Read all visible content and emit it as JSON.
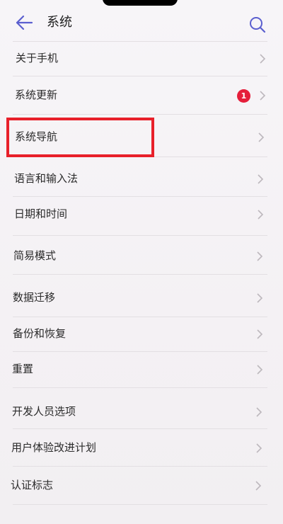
{
  "header": {
    "title": "系统",
    "back_icon": "back-arrow-icon",
    "search_icon": "search-icon"
  },
  "colors": {
    "accent": "#5b5fcf",
    "badge": "#e51e3a",
    "highlight": "#e8202a"
  },
  "settings": {
    "items": [
      {
        "label": "关于手机"
      },
      {
        "label": "系统更新",
        "badge": "1"
      },
      {
        "label": "系统导航"
      },
      {
        "label": "语言和输入法"
      },
      {
        "label": "日期和时间"
      },
      {
        "label": "简易模式"
      },
      {
        "label": "数据迁移"
      },
      {
        "label": "备份和恢复"
      },
      {
        "label": "重置"
      },
      {
        "label": "开发人员选项"
      },
      {
        "label": "用户体验改进计划"
      },
      {
        "label": "认证标志"
      }
    ]
  }
}
